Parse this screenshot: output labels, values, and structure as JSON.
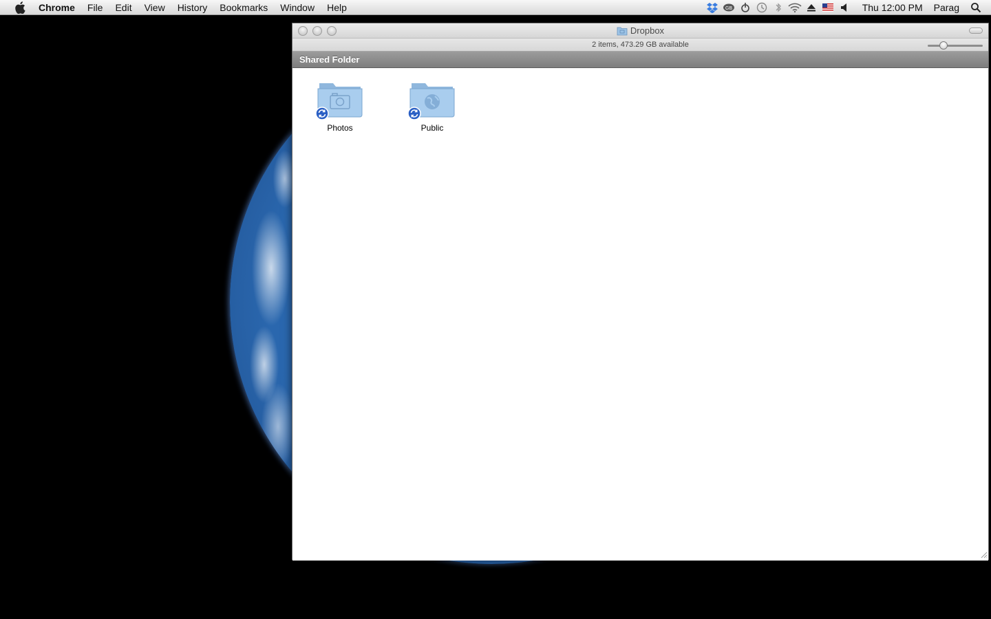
{
  "menubar": {
    "app_name": "Chrome",
    "menus": [
      "File",
      "Edit",
      "View",
      "History",
      "Bookmarks",
      "Window",
      "Help"
    ],
    "status_icons": [
      "dropbox-icon",
      "growl-icon",
      "app-icon",
      "time-machine-icon",
      "bluetooth-icon",
      "wifi-icon",
      "eject-icon",
      "us-flag-icon",
      "volume-icon"
    ],
    "clock": "Thu 12:00 PM",
    "user": "Parag"
  },
  "window": {
    "title": "Dropbox",
    "status_text": "2 items, 473.29 GB available",
    "icon_size_slider_value": 0.25,
    "path_label": "Shared Folder",
    "items": [
      {
        "name": "Photos",
        "icon": "camera-folder-icon"
      },
      {
        "name": "Public",
        "icon": "globe-folder-icon"
      }
    ]
  },
  "colors": {
    "folder_blue": "#9cc3e6",
    "badge_blue": "#2a5fc4",
    "earth_blue": "#2c6fb8"
  }
}
